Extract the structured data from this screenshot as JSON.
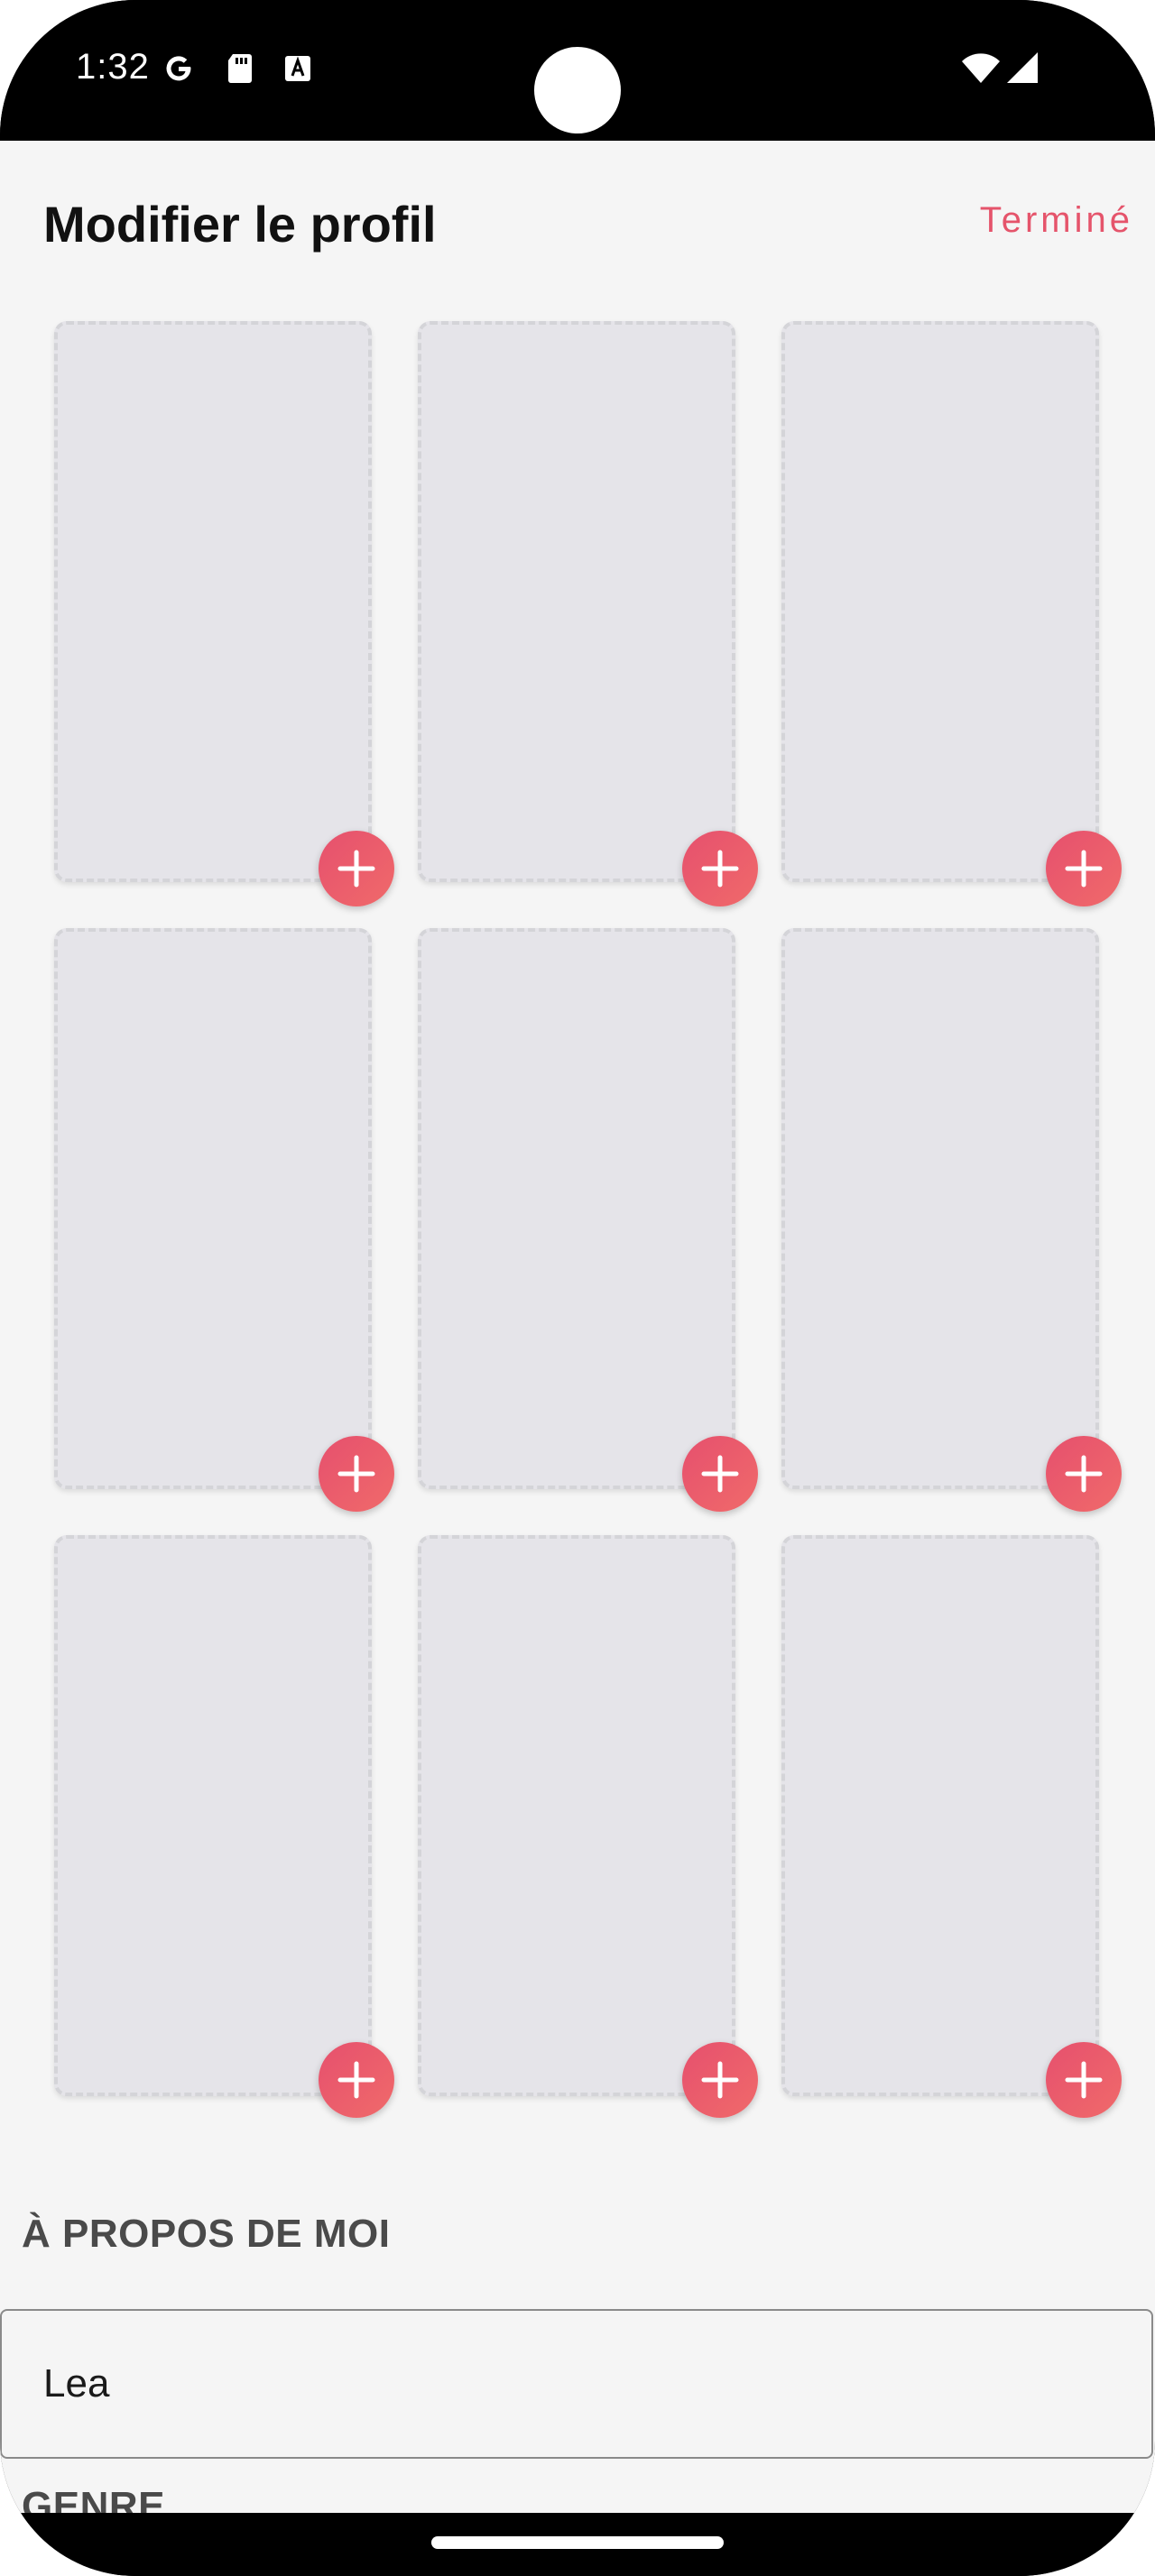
{
  "status_bar": {
    "time": "1:32",
    "icons": [
      "google-icon",
      "sd-card-icon",
      "font-icon",
      "wifi-icon",
      "signal-icon"
    ]
  },
  "header": {
    "title": "Modifier le profil",
    "done_label": "Terminé"
  },
  "photos": {
    "slot_count": 9,
    "add_icon": "plus-icon",
    "add_button_color": "#e9586c"
  },
  "about": {
    "heading": "À PROPOS DE MOI",
    "value": "Lea"
  },
  "gender": {
    "heading": "GENRE"
  },
  "colors": {
    "accent": "#e5546b",
    "background": "#f5f5f5",
    "slot_fill": "#e5e4e9"
  }
}
